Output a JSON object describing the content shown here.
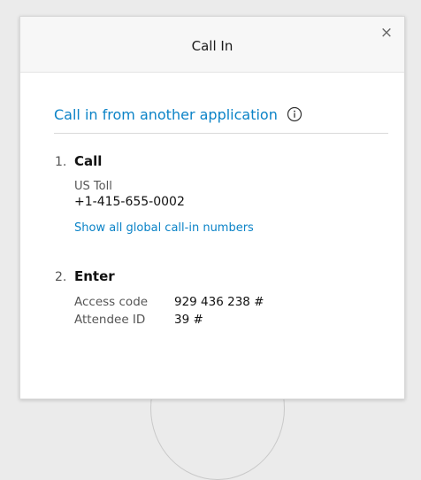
{
  "dialog": {
    "title": "Call In",
    "close_symbol": "×"
  },
  "app_call": {
    "label": "Call in from another application",
    "icon": "info-icon"
  },
  "steps": [
    {
      "number": "1.",
      "title": "Call",
      "toll_label": "US Toll",
      "phone": "+1-415-655-0002",
      "global_link": "Show all global call-in numbers"
    },
    {
      "number": "2.",
      "title": "Enter",
      "fields": [
        {
          "label": "Access code",
          "value": "929 436 238 #"
        },
        {
          "label": "Attendee ID",
          "value": "39 #"
        }
      ]
    }
  ],
  "colors": {
    "link": "#0b83c7",
    "header_bg": "#f7f7f7",
    "backdrop": "#ebebeb"
  }
}
